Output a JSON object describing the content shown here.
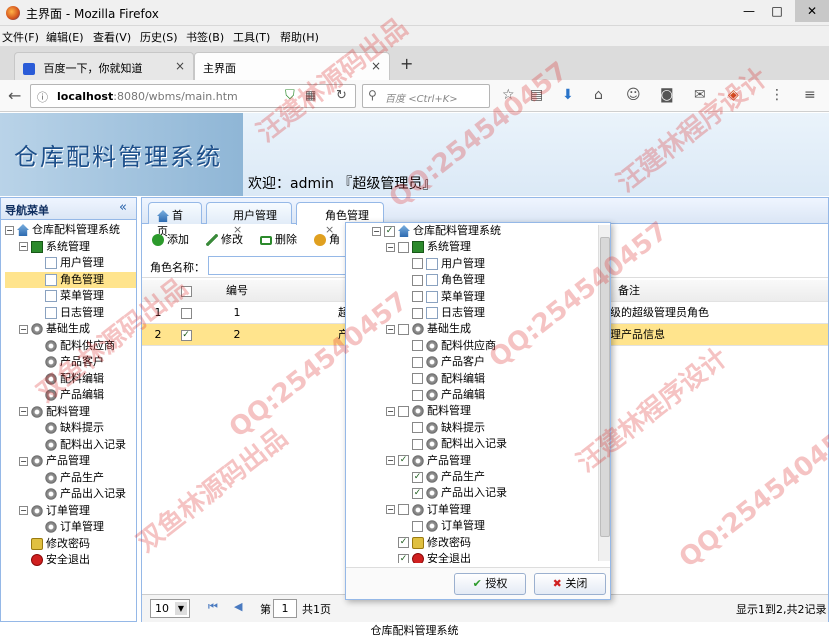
{
  "window": {
    "title": "主界面 - Mozilla Firefox",
    "min": "—",
    "max": "□",
    "close": "✕"
  },
  "menu": [
    "文件(F)",
    "编辑(E)",
    "查看(V)",
    "历史(S)",
    "书签(B)",
    "工具(T)",
    "帮助(H)"
  ],
  "browser_tabs": [
    {
      "label": "百度一下，你就知道",
      "close": "×"
    },
    {
      "label": "主界面",
      "close": "×"
    }
  ],
  "newtab": "+",
  "nav": {
    "url_host": "localhost",
    "url_rest": ":8080/wbms/main.htm",
    "search_engine": "百度",
    "search_placeholder": "<Ctrl+K>"
  },
  "header": {
    "app_title": "仓库配料管理系统",
    "welcome": "欢迎：admin 『超级管理员』"
  },
  "leftnav": {
    "title": "导航菜单",
    "collapse": "«",
    "items": [
      {
        "label": "仓库配料管理系统",
        "icon": "home-icon"
      },
      {
        "label": "系统管理",
        "icon": "green-folder-icon"
      },
      {
        "label": "用户管理",
        "icon": "doc-icon"
      },
      {
        "label": "角色管理",
        "icon": "doc-icon"
      },
      {
        "label": "菜单管理",
        "icon": "doc-icon"
      },
      {
        "label": "日志管理",
        "icon": "doc-icon"
      },
      {
        "label": "基础生成",
        "icon": "gear-icon"
      },
      {
        "label": "配料供应商",
        "icon": "gear-icon"
      },
      {
        "label": "产品客户",
        "icon": "gear-icon"
      },
      {
        "label": "配料编辑",
        "icon": "gear-icon"
      },
      {
        "label": "产品编辑",
        "icon": "gear-icon"
      },
      {
        "label": "配料管理",
        "icon": "gear-icon"
      },
      {
        "label": "缺料提示",
        "icon": "gear-icon"
      },
      {
        "label": "配料出入记录",
        "icon": "gear-icon"
      },
      {
        "label": "产品管理",
        "icon": "gear-icon"
      },
      {
        "label": "产品生产",
        "icon": "gear-icon"
      },
      {
        "label": "产品出入记录",
        "icon": "gear-icon"
      },
      {
        "label": "订单管理",
        "icon": "gear-icon"
      },
      {
        "label": "订单管理",
        "icon": "gear-icon"
      },
      {
        "label": "修改密码",
        "icon": "lock-icon"
      },
      {
        "label": "安全退出",
        "icon": "exit-icon"
      }
    ]
  },
  "tabs": [
    {
      "label": "首页",
      "close": ""
    },
    {
      "label": "用户管理",
      "close": "×"
    },
    {
      "label": "角色管理",
      "close": "×"
    }
  ],
  "toolbar": {
    "add": "添加",
    "edit": "修改",
    "delete": "删除",
    "more": "角"
  },
  "search": {
    "label": "角色名称："
  },
  "grid": {
    "headers": {
      "num": "编号",
      "remark": "备注"
    },
    "rows": [
      {
        "index": "1",
        "num": "1",
        "name_fragment": "超",
        "remark": "级的超级管理员角色",
        "checked": false
      },
      {
        "index": "2",
        "num": "2",
        "name_fragment": "产",
        "remark": "理产品信息",
        "checked": true
      }
    ]
  },
  "pager": {
    "page_size": "10",
    "page_prefix": "第",
    "page": "1",
    "page_suffix": "共1页",
    "info": "显示1到2,共2记录"
  },
  "dialog": {
    "tree": [
      {
        "label": "仓库配料管理系统",
        "checked": true,
        "icon": "home-icon"
      },
      {
        "label": "系统管理",
        "checked": false,
        "icon": "green-folder-icon"
      },
      {
        "label": "用户管理",
        "checked": false,
        "icon": "doc-icon"
      },
      {
        "label": "角色管理",
        "checked": false,
        "icon": "doc-icon"
      },
      {
        "label": "菜单管理",
        "checked": false,
        "icon": "doc-icon"
      },
      {
        "label": "日志管理",
        "checked": false,
        "icon": "doc-icon"
      },
      {
        "label": "基础生成",
        "checked": false,
        "icon": "gear-icon"
      },
      {
        "label": "配料供应商",
        "checked": false,
        "icon": "gear-icon"
      },
      {
        "label": "产品客户",
        "checked": false,
        "icon": "gear-icon"
      },
      {
        "label": "配料编辑",
        "checked": false,
        "icon": "gear-icon"
      },
      {
        "label": "产品编辑",
        "checked": false,
        "icon": "gear-icon"
      },
      {
        "label": "配料管理",
        "checked": false,
        "icon": "gear-icon"
      },
      {
        "label": "缺料提示",
        "checked": false,
        "icon": "gear-icon"
      },
      {
        "label": "配料出入记录",
        "checked": false,
        "icon": "gear-icon"
      },
      {
        "label": "产品管理",
        "checked": true,
        "icon": "gear-icon"
      },
      {
        "label": "产品生产",
        "checked": true,
        "icon": "gear-icon"
      },
      {
        "label": "产品出入记录",
        "checked": true,
        "icon": "gear-icon"
      },
      {
        "label": "订单管理",
        "checked": false,
        "icon": "gear-icon"
      },
      {
        "label": "订单管理",
        "checked": false,
        "icon": "gear-icon"
      },
      {
        "label": "修改密码",
        "checked": true,
        "icon": "lock-icon"
      },
      {
        "label": "安全退出",
        "checked": true,
        "icon": "exit-icon"
      }
    ],
    "ok": "授权",
    "cancel": "关闭"
  },
  "footer": "仓库配料管理系统",
  "watermarks": [
    "汪建林源码出品",
    "QQ:254540457",
    "汪建林程序设计",
    "双鱼林源码出品"
  ],
  "colors": {
    "accent": "#95b8e7",
    "highlight": "#ffe48d"
  }
}
